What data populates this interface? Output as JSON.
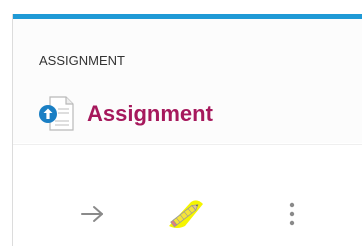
{
  "activity": {
    "type_label": "ASSIGNMENT",
    "title": "Assignment",
    "icon": "assignment-upload-icon"
  },
  "actions": [
    {
      "name": "go-arrow-icon"
    },
    {
      "name": "edit-pencil-icon"
    },
    {
      "name": "more-vertical-icon"
    }
  ],
  "colors": {
    "accent_bar": "#1f9ad6",
    "title": "#a6185c",
    "edit_highlight": "#f5f500",
    "icon_grey": "#8a8a8a"
  }
}
